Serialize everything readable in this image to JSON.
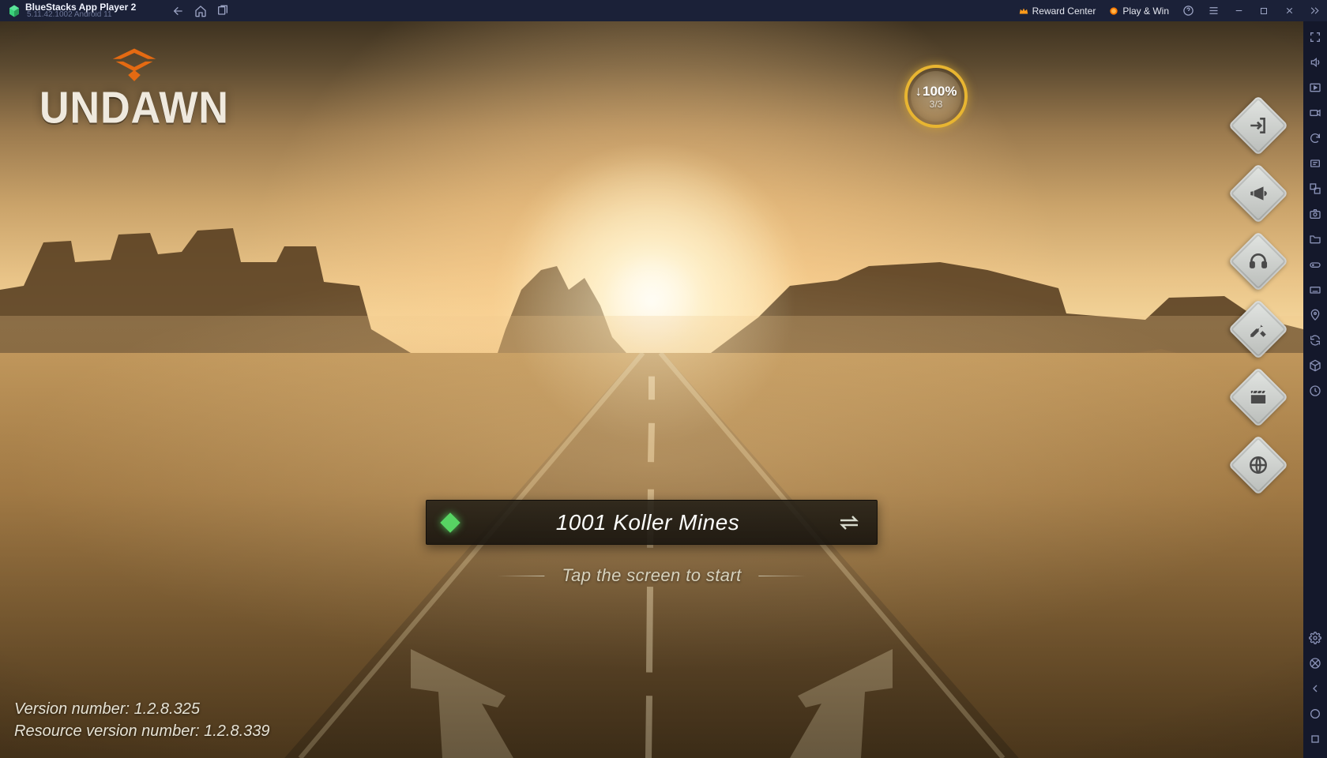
{
  "titlebar": {
    "app_name": "BlueStacks App Player 2",
    "version_line": "5.11.42.1002  Android 11",
    "reward_center": "Reward Center",
    "play_win": "Play & Win"
  },
  "sidebar_icons": [
    "fullscreen-icon",
    "volume-icon",
    "playback-icon",
    "record-icon",
    "sync-icon",
    "macro-icon",
    "multi-instance-icon",
    "screenshot-icon",
    "folder-icon",
    "gamepad-icon",
    "location-icon",
    "rotate-icon",
    "shake-icon",
    "package-icon",
    "history-icon"
  ],
  "game": {
    "logo_text": "UNDAWN",
    "download": {
      "percent": "100%",
      "progress": "3/3"
    },
    "menu_icons": [
      "logout-icon",
      "announce-icon",
      "support-icon",
      "repair-icon",
      "media-icon",
      "region-icon"
    ],
    "server": {
      "id": "1001",
      "name_full": "1001 Koller Mines"
    },
    "tap_text": "Tap the screen to start",
    "version_label": "Version number:",
    "version_value": "1.2.8.325",
    "resource_label": "Resource version number:",
    "resource_value": "1.2.8.339"
  }
}
